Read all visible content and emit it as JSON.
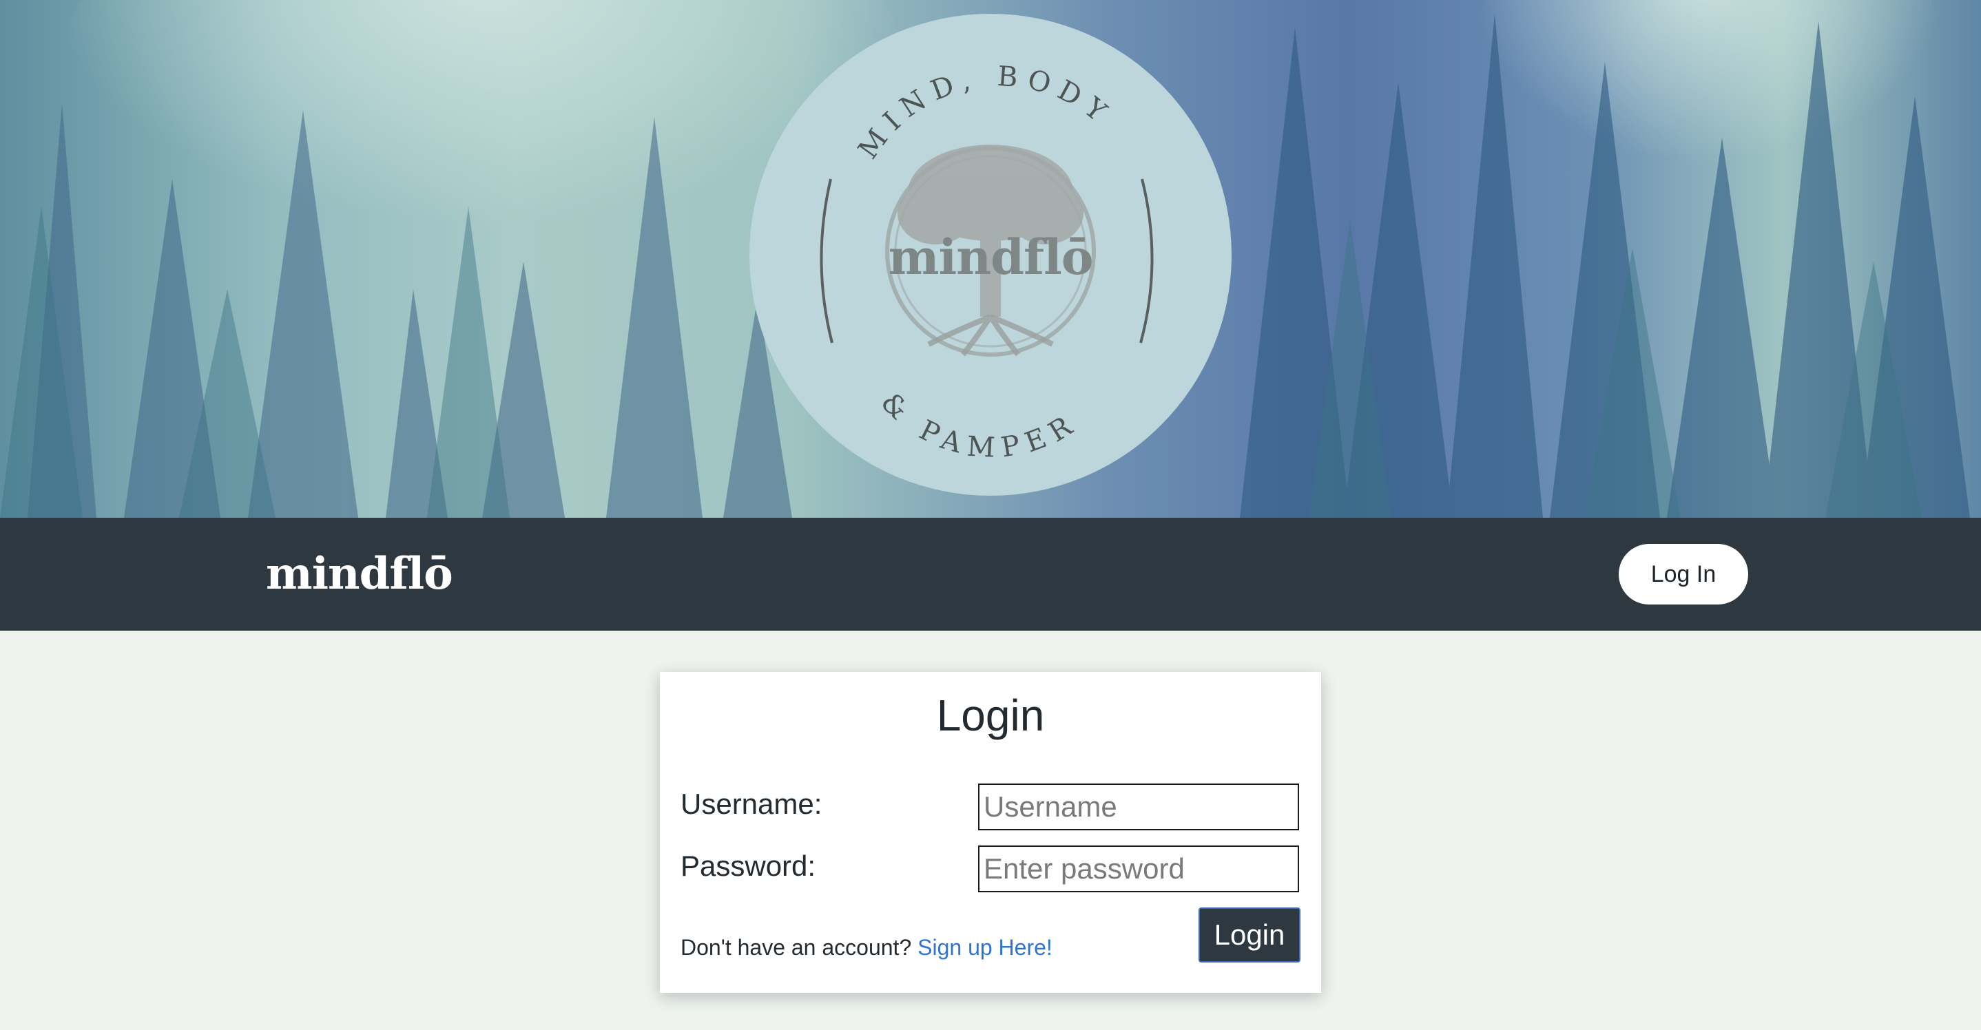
{
  "hero": {
    "emblem_top_text": "MIND, BODY",
    "emblem_bottom_text": "& PAMPER",
    "emblem_wordmark": "mindflō"
  },
  "navbar": {
    "brand": "mindflō",
    "login_button": "Log In"
  },
  "login_form": {
    "title": "Login",
    "username_label": "Username:",
    "username_placeholder": "Username",
    "username_value": "",
    "password_label": "Password:",
    "password_placeholder": "Enter password",
    "password_value": "",
    "signup_prompt": "Don't have an account?",
    "signup_link": "Sign up Here!",
    "submit_button": "Login"
  },
  "colors": {
    "navbar_bg": "#2e3840",
    "page_bg": "#eef3ef",
    "emblem_bg": "#bcd6db",
    "link": "#2f74d0",
    "submit_border": "#3d6db0"
  },
  "icons": {
    "emblem_tree": "tree-of-life-icon"
  }
}
